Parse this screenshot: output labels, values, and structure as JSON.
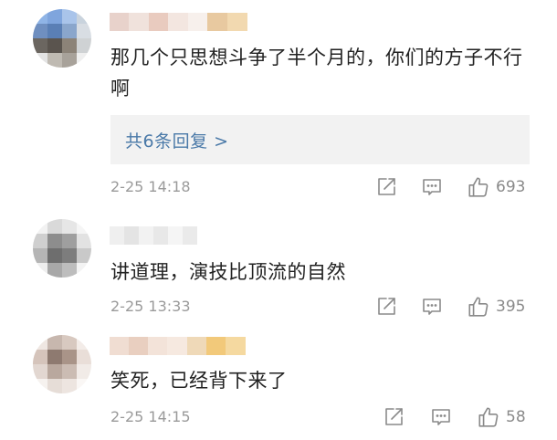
{
  "comments": [
    {
      "text": "那几个只思想斗争了半个月的，你们的方子不行啊",
      "reply_link": "共6条回复 >",
      "timestamp": "2-25 14:18",
      "likes": "693",
      "avatar_colors": [
        "#8fb4e6",
        "#7fa5dd",
        "#a9c4ea",
        "#c9d3dd",
        "#6f8fc0",
        "#5a7fb5",
        "#8aa6cc",
        "#d8dde3",
        "#6b6660",
        "#5a544e",
        "#8c8378",
        "#cfd2d4",
        "#e3e3e3",
        "#bfbab2",
        "#a8a29a",
        "#efefef"
      ],
      "username_colors": [
        "#e8d2cb",
        "#f0e2dc",
        "#e9cbbf",
        "#f3e6e0",
        "#f7f0ec",
        "#e8c9a0",
        "#f2d9b0"
      ]
    },
    {
      "text": "讲道理，演技比顶流的自然",
      "timestamp": "2-25 13:33",
      "likes": "395",
      "avatar_colors": [
        "#f2f2f2",
        "#d9d9d9",
        "#e6e6e6",
        "#f5f5f5",
        "#cfcfcf",
        "#8d8d8d",
        "#9f9f9f",
        "#e2e2e2",
        "#b5b5b5",
        "#6e6e6e",
        "#7d7d7d",
        "#c9c9c9",
        "#eeeeee",
        "#a8a8a8",
        "#bdbdbd",
        "#f3f3f3"
      ],
      "username_colors": [
        "#efefef",
        "#e4e4e4",
        "#f2f2f2",
        "#e8e8e8",
        "#f5f5f5",
        "#eaeaea"
      ]
    },
    {
      "text": "笑死，已经背下来了",
      "timestamp": "2-25 14:15",
      "likes": "58",
      "avatar_colors": [
        "#efe7e2",
        "#c7b7ae",
        "#d8c9c0",
        "#f3ece8",
        "#d5c4bb",
        "#8e7a70",
        "#a99488",
        "#e9ded8",
        "#e2d7d1",
        "#b9a89e",
        "#cbbcb3",
        "#f1ebe7",
        "#f6f2ef",
        "#e6ddd7",
        "#ede5e0",
        "#faf7f5"
      ],
      "username_colors": [
        "#f0ddd2",
        "#e9cfc0",
        "#f3e3d9",
        "#f6e9e0",
        "#efd9b8",
        "#f2c97a",
        "#f5d9a0"
      ]
    }
  ],
  "icons": {
    "share": "share-icon",
    "comment": "comment-icon",
    "like": "thumbs-up-icon"
  },
  "colors": {
    "text": "#222222",
    "link": "#4a79a8",
    "meta": "#9a9a9a",
    "reply_bg": "#f2f2f2"
  }
}
